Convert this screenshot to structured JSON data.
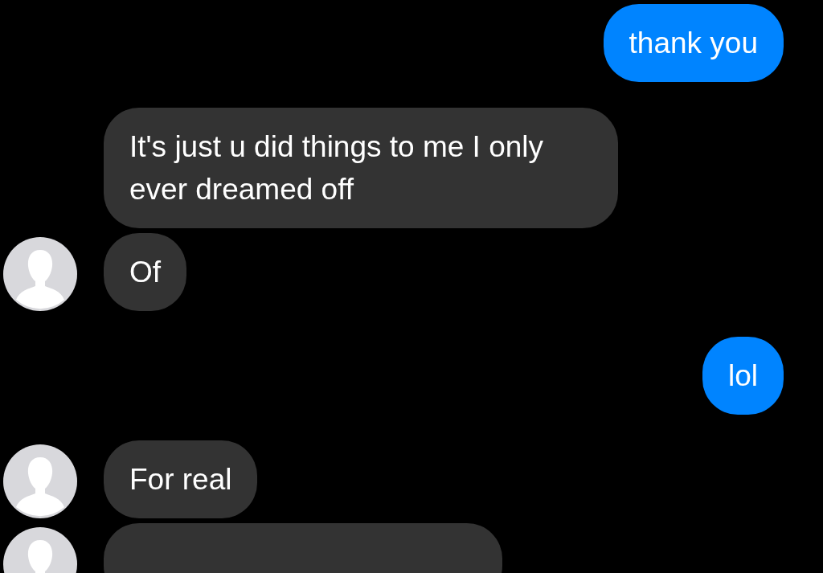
{
  "messages": [
    {
      "kind": "outgoing",
      "text": "thank you"
    },
    {
      "kind": "incoming",
      "avatar": false,
      "text": "It's just u did things to me I only ever dreamed off"
    },
    {
      "kind": "incoming",
      "avatar": true,
      "text": "Of"
    },
    {
      "kind": "outgoing",
      "text": "lol"
    },
    {
      "kind": "incoming",
      "avatar": true,
      "text": "For real"
    },
    {
      "kind": "incoming",
      "avatar": true
    }
  ]
}
